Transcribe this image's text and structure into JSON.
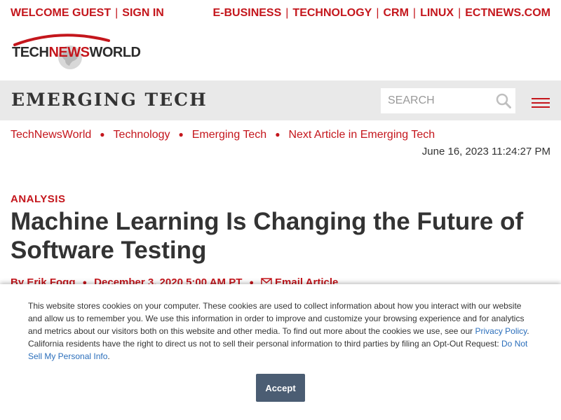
{
  "topbar": {
    "welcome": "WELCOME GUEST",
    "sign_in": "SIGN IN",
    "links": [
      "E-BUSINESS",
      "TECHNOLOGY",
      "CRM",
      "LINUX",
      "ECTNEWS.COM"
    ]
  },
  "logo": {
    "part1": "TECH",
    "part2": "NEWS",
    "part3": "WORLD"
  },
  "section": {
    "title": "EMERGING TECH",
    "search_placeholder": "SEARCH"
  },
  "breadcrumb": {
    "items": [
      "TechNewsWorld",
      "Technology",
      "Emerging Tech",
      "Next Article in Emerging Tech"
    ]
  },
  "timestamp": "June 16, 2023 11:24:27 PM",
  "article": {
    "kicker": "ANALYSIS",
    "headline": "Machine Learning Is Changing the Future of Software Testing",
    "author": "By Erik Fogg",
    "date": "December 3, 2020 5:00 AM PT",
    "email_label": "Email Article"
  },
  "cookie": {
    "text_1": "This website stores cookies on your computer. These cookies are used to collect information about how you interact with our website and allow us to remember you. We use this information in order to improve and customize your browsing experience and for analytics and metrics about our visitors both on this website and other media. To find out more about the cookies we use, see our ",
    "privacy_link": "Privacy Policy",
    "text_2": ". California residents have the right to direct us not to sell their personal information to third parties by filing an Opt-Out Request: ",
    "optout_link": "Do Not Sell My Personal Info",
    "text_3": ".",
    "accept_label": "Accept"
  },
  "colors": {
    "brand_red": "#c4161c",
    "section_bg": "#e9e9e9",
    "accept_bg": "#4b5d73",
    "link_blue": "#2a6ebb"
  },
  "icons": [
    "search-icon",
    "hamburger-menu-icon",
    "globe-icon",
    "mail-icon"
  ]
}
